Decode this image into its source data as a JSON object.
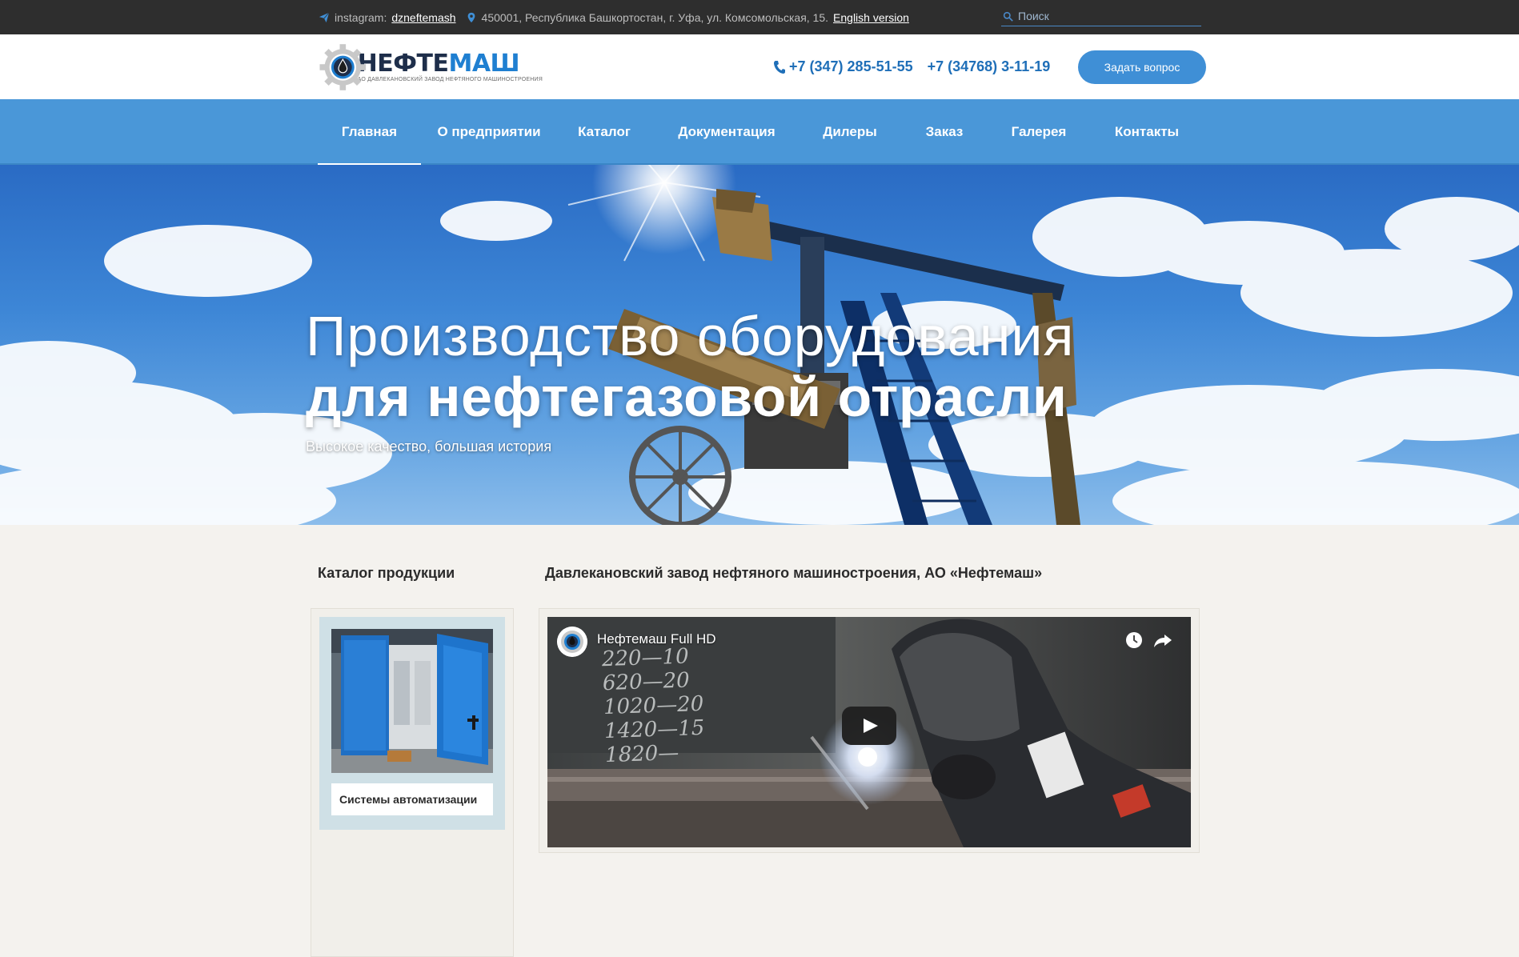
{
  "topbar": {
    "instagram_label": "instagram:",
    "instagram_handle": "dzneftemash",
    "address": "450001, Республика Башкортостан, г. Уфа, ул. Комсомольская, 15.",
    "english_link": "English version",
    "search_placeholder": "Поиск"
  },
  "header": {
    "logo_dark": "НЕФТЕ",
    "logo_blue": "МАШ",
    "logo_sub": "АО ДАВЛЕКАНОВСКИЙ ЗАВОД НЕФТЯНОГО МАШИНОСТРОЕНИЯ",
    "phone1": "+7 (347) 285-51-55",
    "phone2": "+7 (34768) 3-11-19",
    "ask_button": "Задать вопрос"
  },
  "nav": {
    "items": [
      {
        "label": "Главная",
        "active": true
      },
      {
        "label": "О предприятии",
        "active": false
      },
      {
        "label": "Каталог",
        "active": false
      },
      {
        "label": "Документация",
        "active": false
      },
      {
        "label": "Дилеры",
        "active": false
      },
      {
        "label": "Заказ",
        "active": false
      },
      {
        "label": "Галерея",
        "active": false
      },
      {
        "label": "Контакты",
        "active": false
      }
    ]
  },
  "hero": {
    "title_line1": "Производство оборудования",
    "title_line2": "для нефтегазовой отрасли",
    "subtitle": "Высокое качество, большая история"
  },
  "content": {
    "catalog_heading": "Каталог продукции",
    "about_heading": "Давлекановский завод нефтяного машиностроения, АО «Нефтемаш»",
    "catalog_items": [
      {
        "label": "Системы автоматизации"
      }
    ],
    "video_title": "Нефтемаш Full HD",
    "board_lines": [
      "220—10",
      "620—20",
      "1020—20",
      "1420—15",
      "1820—"
    ]
  },
  "colors": {
    "topbar_bg": "#2e2e2e",
    "nav_bg": "#4a97d8",
    "accent_blue": "#3f8fd6",
    "phone_blue": "#1f6fb8",
    "page_bg": "#f4f2ee"
  }
}
